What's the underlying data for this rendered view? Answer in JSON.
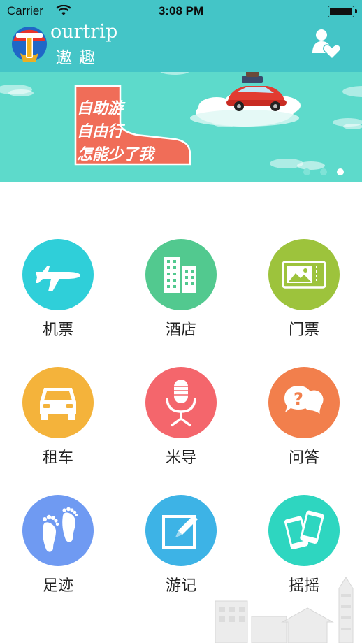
{
  "status_bar": {
    "carrier": "Carrier",
    "time": "3:08 PM"
  },
  "header": {
    "brand_en": "ourtrip",
    "brand_cn": "遨趣",
    "logo_letter": "T"
  },
  "banner": {
    "line1": "自助游",
    "line2": "自由行",
    "line3": "怎能少了我",
    "active_slide": 2,
    "slide_count": 3
  },
  "colors": {
    "header_bg": "#44c5c7",
    "banner_bg": "#5ddacb",
    "boot": "#f06d58",
    "flight": "#2fcfd9",
    "hotel": "#52c98f",
    "ticket": "#9dc33c",
    "car": "#f4b33b",
    "guide": "#f4666c",
    "qa": "#f27f4c",
    "footprint": "#6f9af2",
    "travelogue": "#3db3e6",
    "shake": "#2ed6c0"
  },
  "menu": [
    {
      "label": "机票",
      "icon": "airplane-icon"
    },
    {
      "label": "酒店",
      "icon": "buildings-icon"
    },
    {
      "label": "门票",
      "icon": "ticket-icon"
    },
    {
      "label": "租车",
      "icon": "car-icon"
    },
    {
      "label": "米导",
      "icon": "microphone-icon"
    },
    {
      "label": "问答",
      "icon": "chat-question-icon"
    },
    {
      "label": "足迹",
      "icon": "footprints-icon"
    },
    {
      "label": "游记",
      "icon": "edit-note-icon"
    },
    {
      "label": "摇摇",
      "icon": "phones-shake-icon"
    }
  ]
}
